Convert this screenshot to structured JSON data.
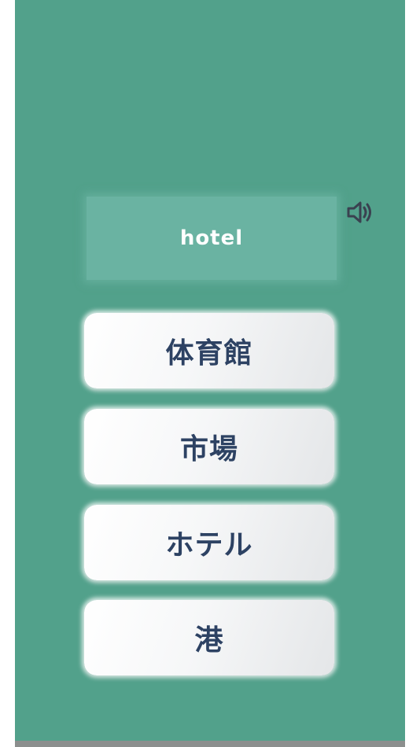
{
  "quiz": {
    "word": "hotel",
    "audio_icon": "speaker-icon",
    "choices": [
      {
        "label": "体育館"
      },
      {
        "label": "市場"
      },
      {
        "label": "ホテル"
      },
      {
        "label": "港"
      }
    ]
  },
  "colors": {
    "background": "#52a18b",
    "word_card": "#6ab3a2",
    "choice_text": "#2d4263",
    "button": "#f6f7f8"
  }
}
